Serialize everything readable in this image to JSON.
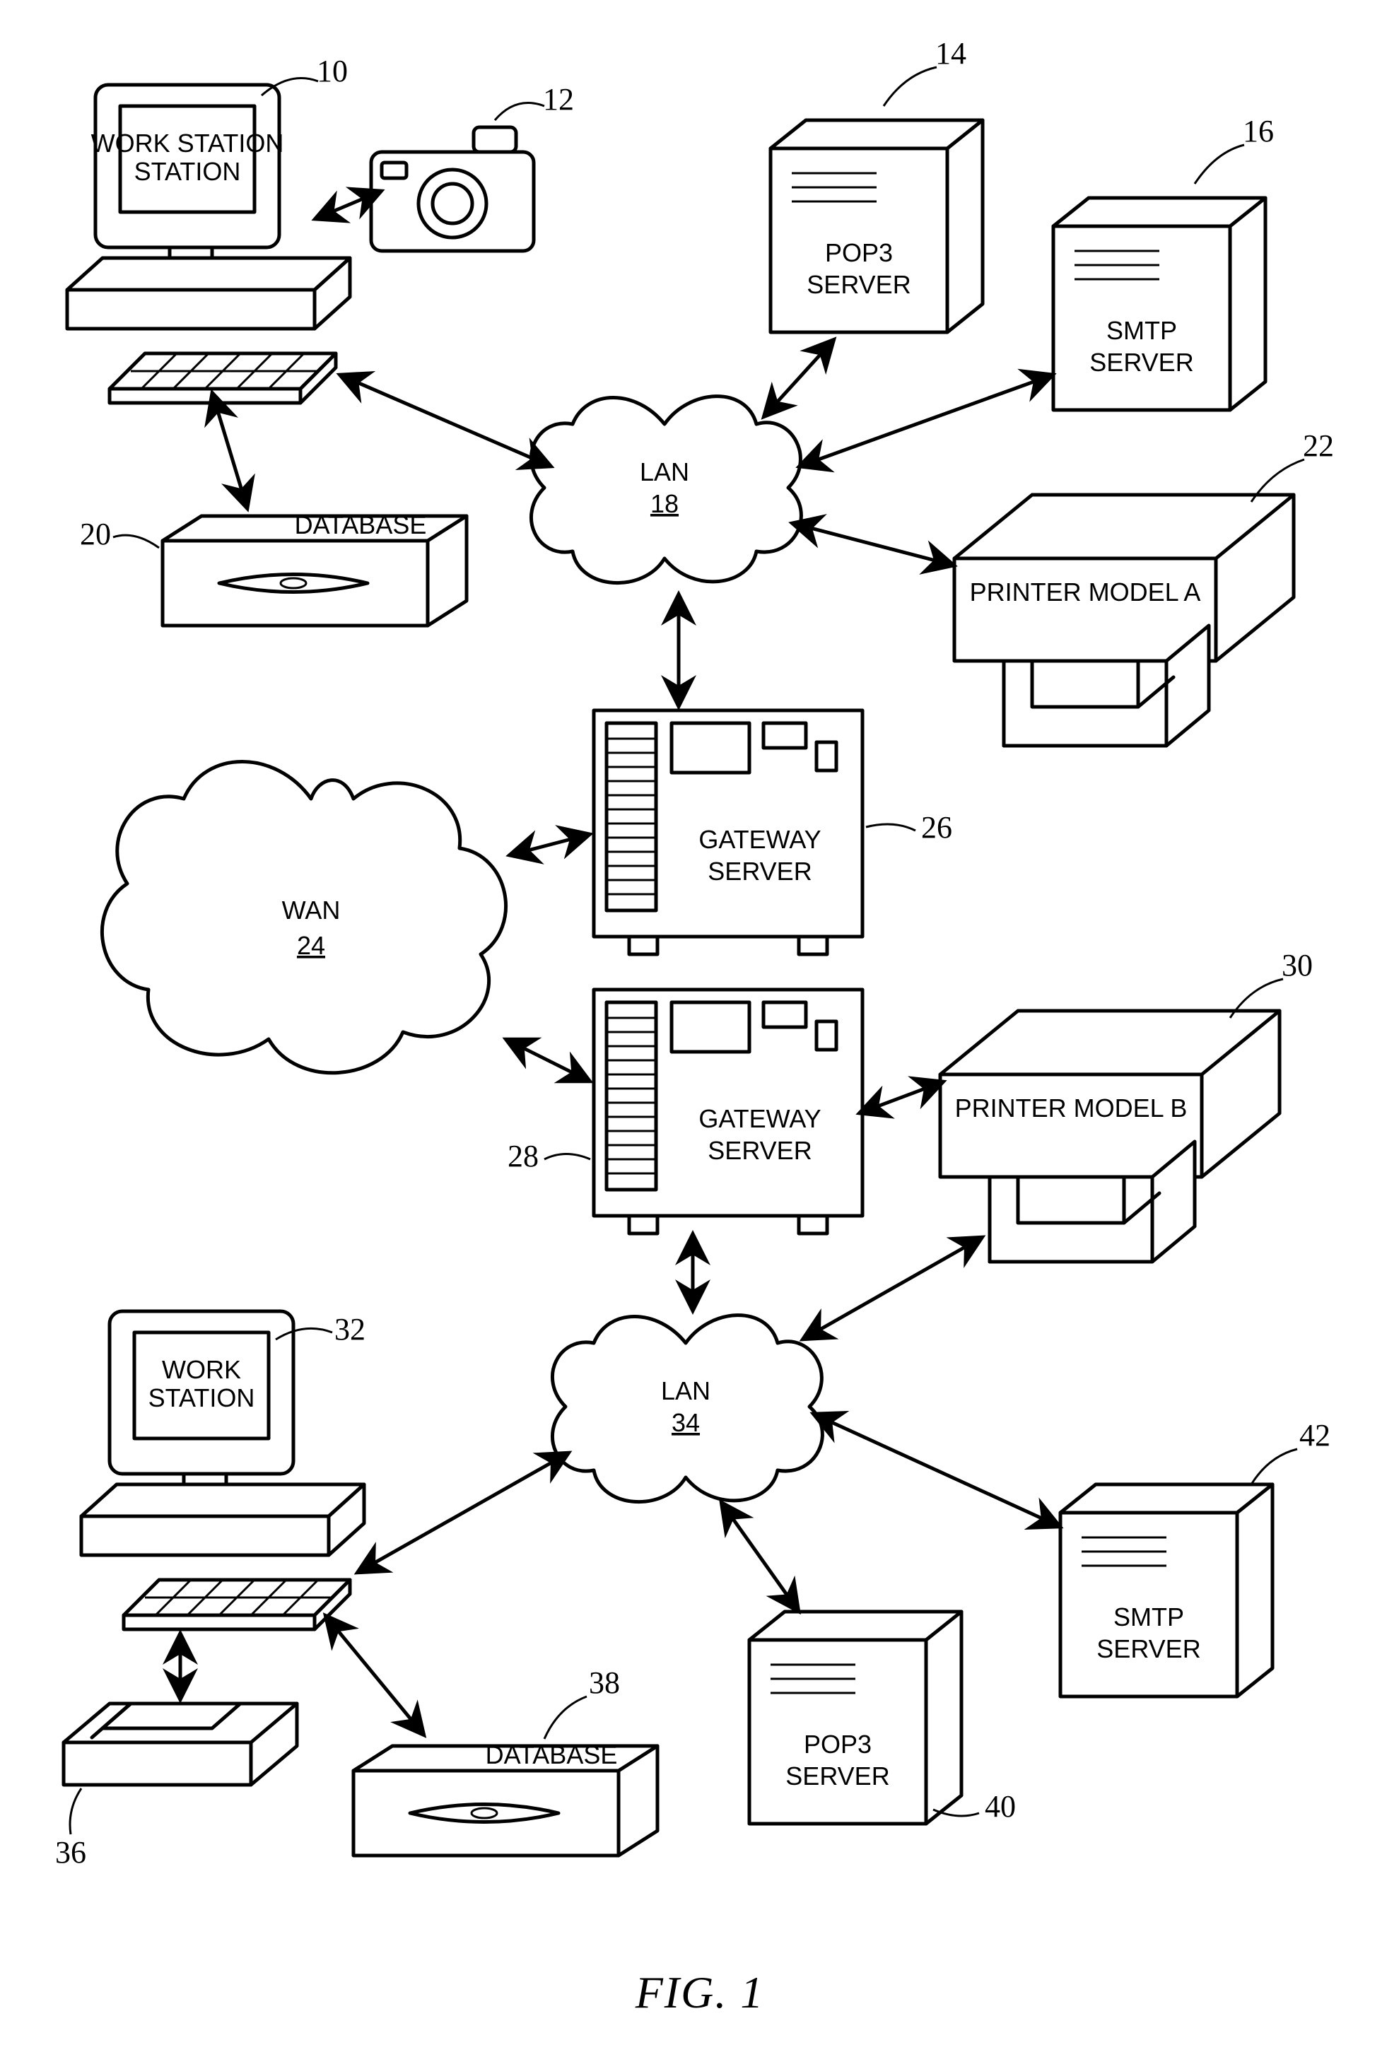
{
  "figure_label": "FIG. 1",
  "nodes": {
    "workstation1": {
      "label": "WORK\nSTATION",
      "ref": "10"
    },
    "camera": {
      "label": "",
      "ref": "12"
    },
    "pop3_top": {
      "label": "POP3\nSERVER",
      "ref": "14"
    },
    "smtp_top": {
      "label": "SMTP\nSERVER",
      "ref": "16"
    },
    "lan_top": {
      "label": "LAN",
      "ref": "18"
    },
    "database1": {
      "label": "DATABASE",
      "ref": "20"
    },
    "printer_a": {
      "label": "PRINTER MODEL A",
      "ref": "22"
    },
    "wan": {
      "label": "WAN",
      "ref": "24"
    },
    "gateway1": {
      "label": "GATEWAY\nSERVER",
      "ref": "26"
    },
    "gateway2": {
      "label": "GATEWAY\nSERVER",
      "ref": "28"
    },
    "printer_b": {
      "label": "PRINTER MODEL B",
      "ref": "30"
    },
    "workstation2": {
      "label": "WORK\nSTATION",
      "ref": "32"
    },
    "lan_bot": {
      "label": "LAN",
      "ref": "34"
    },
    "scanner": {
      "label": "",
      "ref": "36"
    },
    "database2": {
      "label": "DATABASE",
      "ref": "38"
    },
    "pop3_bot": {
      "label": "POP3\nSERVER",
      "ref": "40"
    },
    "smtp_bot": {
      "label": "SMTP\nSERVER",
      "ref": "42"
    }
  }
}
